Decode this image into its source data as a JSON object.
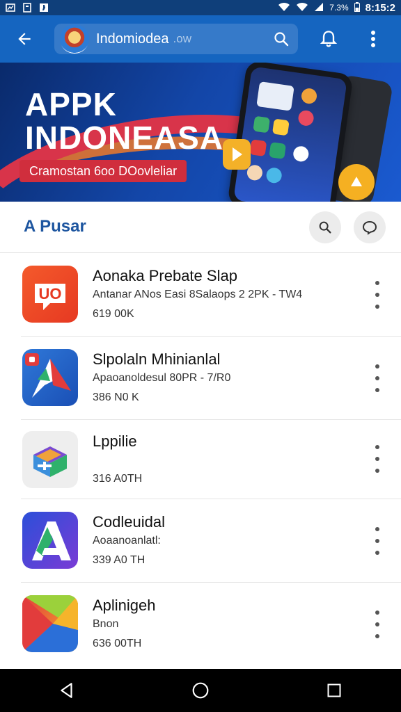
{
  "status_bar": {
    "battery": "7.3%",
    "time": "8:15:2"
  },
  "app_bar": {
    "search_text": "Indomiodea",
    "search_suffix": ".ow",
    "icons": [
      "back-arrow-icon",
      "logo",
      "search-icon",
      "bell-icon",
      "more-vert-icon"
    ]
  },
  "banner": {
    "title_line1": "APPK",
    "title_line2": "INDONEASA",
    "badge": "Cramostan  6oo  DOovleliar"
  },
  "section": {
    "title": "A Pusar"
  },
  "apps": [
    {
      "name": "Aonaka Prebate Slap",
      "sub": "Antanar ANos Easi 8Salaops 2 2PK - TW4",
      "size": "619 00K"
    },
    {
      "name": "Slpolaln Mhinianlal",
      "sub": "Apaoanoldesul 80PR - 7/R0",
      "size": "386 N0 K"
    },
    {
      "name": "Lppilie",
      "sub": "",
      "size": "316 A0TH"
    },
    {
      "name": "Codleuidal",
      "sub": "Aoaanoanlatl:",
      "size": "339 A0 TH"
    },
    {
      "name": "Aplinigeh",
      "sub": "Bnon",
      "size": "636 00TH"
    }
  ],
  "colors": {
    "app_bar": "#1565c0",
    "status_bar": "#0f3f7a",
    "accent": "#1e56a0",
    "badge": "#d02e3d"
  }
}
